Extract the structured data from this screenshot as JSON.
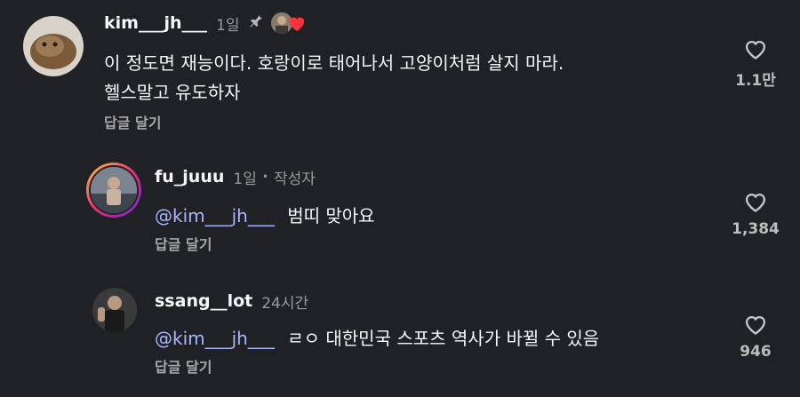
{
  "comments": [
    {
      "username": "kim___jh___",
      "time": "1일",
      "pinned": true,
      "creator_liked": true,
      "text_line1": "이 정도면 재능이다. 호랑이로 태어나서 고양이처럼 살지 마라.",
      "text_line2": "헬스말고 유도하자",
      "reply_label": "답글 달기",
      "like_count": "1.1만",
      "icons": {
        "pin": "pin-icon",
        "liked": "heart-icon",
        "like": "heart-outline-icon"
      }
    },
    {
      "username": "fu_juuu",
      "time": "1일",
      "separator": "•",
      "author_tag": "작성자",
      "mention": "@kim___jh___",
      "text": "범띠 맞아요",
      "reply_label": "답글 달기",
      "like_count": "1,384"
    },
    {
      "username": "ssang__lot",
      "time": "24시간",
      "mention": "@kim___jh___",
      "text": "ㄹㅇ 대한민국 스포츠 역사가 바뀔 수 있음",
      "reply_label": "답글 달기",
      "like_count": "946"
    }
  ],
  "colors": {
    "background": "#202124",
    "mention": "#a8b7ff",
    "secondary_text": "#9a9a9a",
    "liked_heart": "#ff3040"
  }
}
